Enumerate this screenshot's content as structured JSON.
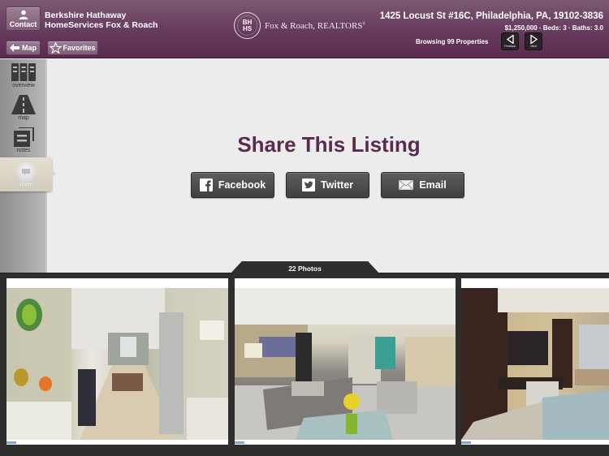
{
  "header": {
    "contact_label": "Contact",
    "map_label": "Map",
    "favorites_label": "Favorites",
    "brand_line1": "Berkshire Hathaway",
    "brand_line2": "HomeServices Fox & Roach",
    "logo_monogram_top": "BH",
    "logo_monogram_bottom": "HS",
    "logo_name": "Fox & Roach, REALTORS",
    "logo_mark": "®",
    "address": "1425 Locust St #16C, Philadelphia, PA, 19102-3836",
    "summary": "$1,250,000 · Beds: 3 · Baths: 3.0",
    "browsing": "Browsing 99 Properties",
    "previous_label": "Previous",
    "next_label": "Next"
  },
  "sidebar": {
    "items": [
      {
        "label": "overview",
        "icon": "binders-icon"
      },
      {
        "label": "map",
        "icon": "road-icon"
      },
      {
        "label": "notes",
        "icon": "notes-icon"
      },
      {
        "label": "share",
        "icon": "share-icon",
        "active": true
      }
    ]
  },
  "main": {
    "title": "Share This Listing",
    "buttons": [
      {
        "label": "Facebook",
        "icon": "facebook-icon"
      },
      {
        "label": "Twitter",
        "icon": "twitter-icon"
      },
      {
        "label": "Email",
        "icon": "envelope-icon"
      }
    ]
  },
  "photos": {
    "count_label": "22 Photos",
    "items": [
      {
        "description": "Entry hallway with glass shelving"
      },
      {
        "description": "Living room with sectional and glass coffee table"
      },
      {
        "description": "Family room with wall-mounted TV"
      }
    ]
  },
  "colors": {
    "brand_purple": "#5b2a4f",
    "header_purple": "#6a3f61",
    "button_dark": "#4a4a4a"
  }
}
